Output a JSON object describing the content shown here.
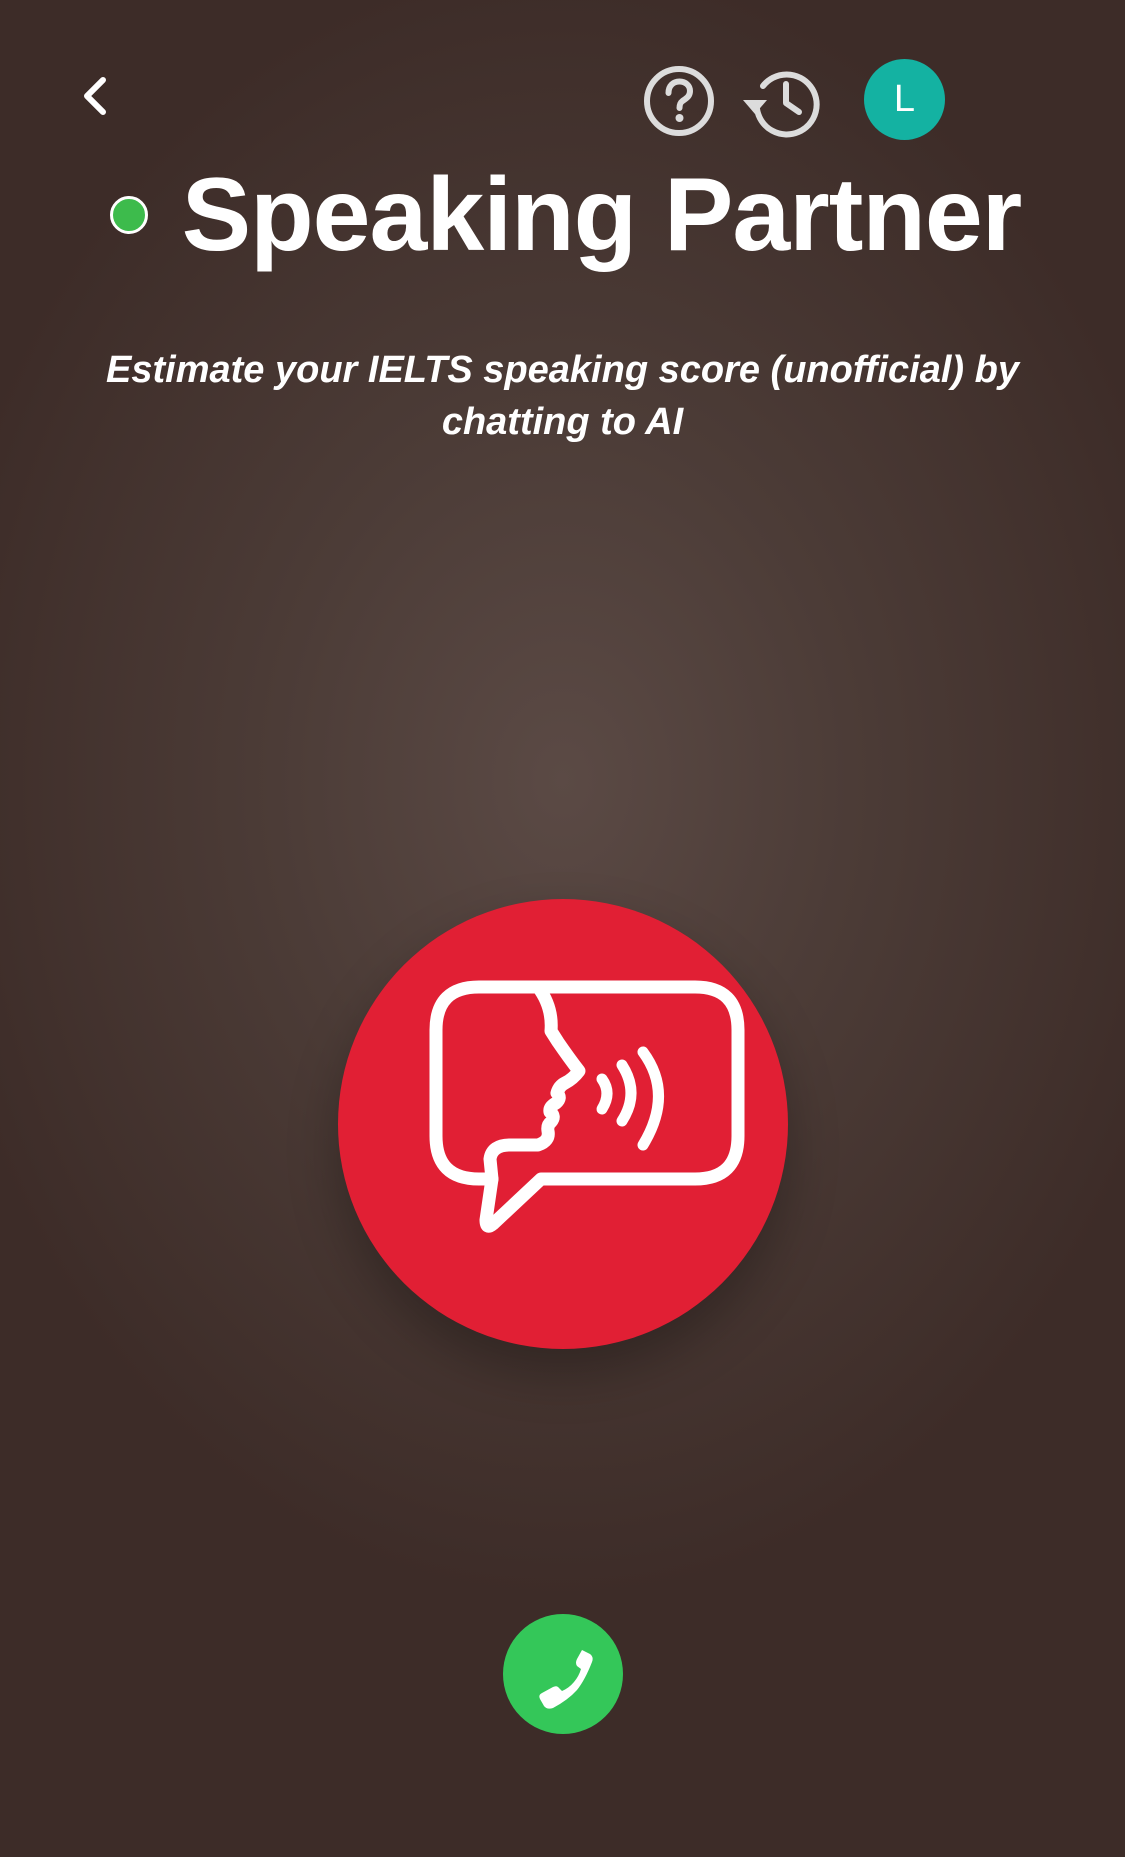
{
  "header": {
    "back_icon": "chevron-left-icon",
    "help_icon": "question-circle-icon",
    "history_icon": "history-clock-icon",
    "avatar_initial": "L",
    "avatar_color": "#14b2a2"
  },
  "title": {
    "text": "Speaking Partner",
    "status_color": "#3dbb4c"
  },
  "subtitle": "Estimate your IELTS speaking score (unofficial) by chatting to AI",
  "speak_button": {
    "icon": "speaking-head-icon",
    "color": "#e11f34"
  },
  "call_button": {
    "icon": "phone-icon",
    "color": "#34c759"
  }
}
